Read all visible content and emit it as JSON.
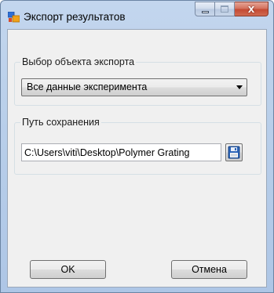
{
  "window": {
    "title": "Экспорт результатов",
    "close_glyph": "x",
    "icons": {
      "app": "app-window-icon",
      "minimize": "minimize-icon",
      "maximize": "maximize-icon",
      "close": "close-icon"
    }
  },
  "export_object": {
    "label": "Выбор объекта экспорта",
    "selected": "Все данные эксперимента"
  },
  "save_path": {
    "label": "Путь сохранения",
    "value": "C:\\Users\\viti\\Desktop\\Polymer Grating",
    "button_icon": "floppy-disk-icon"
  },
  "buttons": {
    "ok_label": "OK",
    "cancel_label": "Отмена"
  },
  "colors": {
    "accent_blue": "#2b64b8",
    "close_red": "#c44a33"
  }
}
